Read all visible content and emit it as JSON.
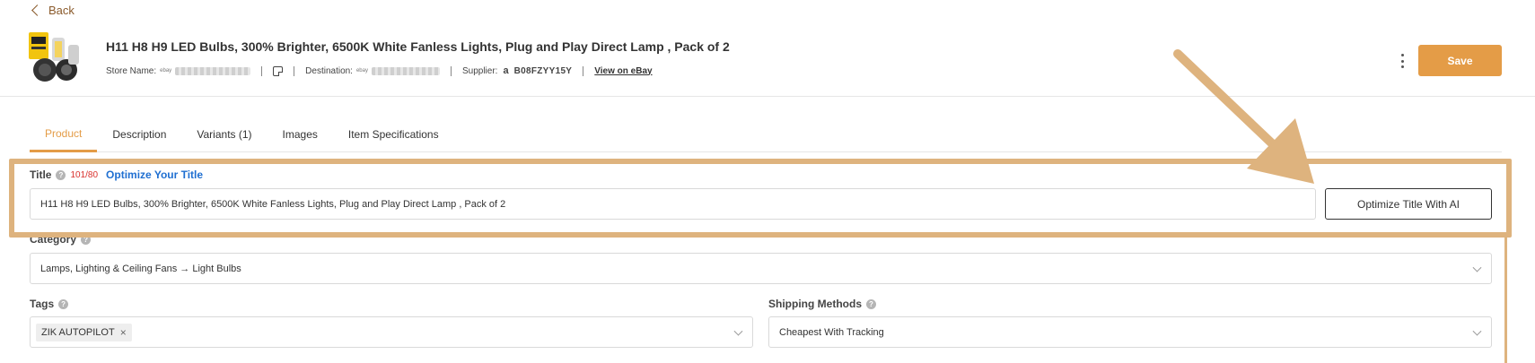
{
  "nav": {
    "back_label": "Back"
  },
  "product": {
    "title": "H11 H8 H9 LED Bulbs, 300% Brighter, 6500K White Fanless Lights, Plug and Play Direct Lamp , Pack of 2",
    "store_label": "Store Name:",
    "destination_label": "Destination:",
    "supplier_label": "Supplier:",
    "supplier_id": "B08FZYY15Y",
    "ebay_link": "View on eBay",
    "ebay_tag": "ebay"
  },
  "header": {
    "save_label": "Save"
  },
  "tabs": [
    {
      "label": "Product",
      "active": true
    },
    {
      "label": "Description",
      "active": false
    },
    {
      "label": "Variants (1)",
      "active": false
    },
    {
      "label": "Images",
      "active": false
    },
    {
      "label": "Item Specifications",
      "active": false
    }
  ],
  "form": {
    "title_label": "Title",
    "title_count": "101/80",
    "optimize_link": "Optimize Your Title",
    "title_value": "H11 H8 H9 LED Bulbs, 300% Brighter, 6500K White Fanless Lights, Plug and Play Direct Lamp , Pack of 2",
    "optimize_ai_label": "Optimize Title With AI",
    "category_label": "Category",
    "category_value": "Lamps, Lighting & Ceiling Fans → Light Bulbs",
    "tags_label": "Tags",
    "tag_chip": "ZIK AUTOPILOT",
    "shipping_label": "Shipping Methods",
    "shipping_value": "Cheapest With Tracking"
  },
  "colors": {
    "accent": "#e49c47",
    "highlight": "#deb37e",
    "link": "#1f6fd1",
    "error": "#d9302c"
  },
  "icons": [
    "chevron-left-icon",
    "note-icon",
    "amazon-icon",
    "kebab-menu-icon",
    "help-icon",
    "chevron-down-icon",
    "close-icon"
  ]
}
